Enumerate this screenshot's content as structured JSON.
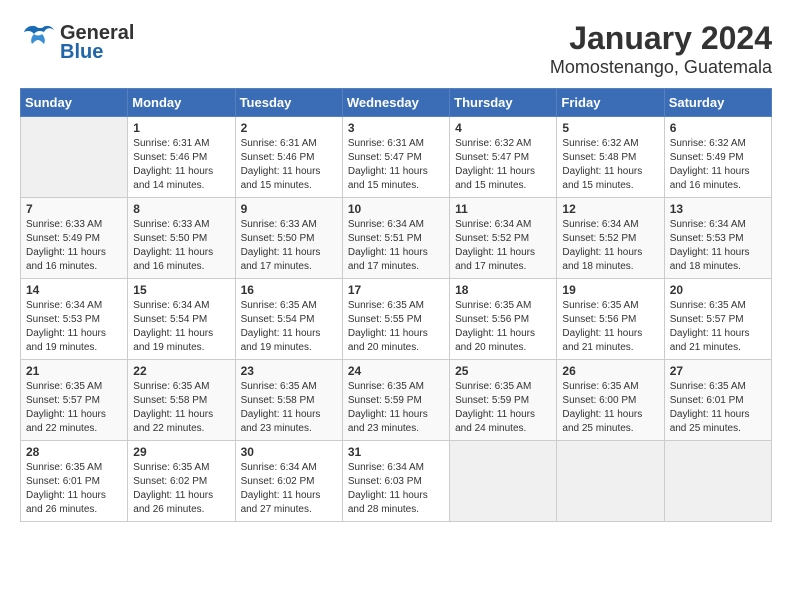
{
  "header": {
    "logo_general": "General",
    "logo_blue": "Blue",
    "title": "January 2024",
    "subtitle": "Momostenango, Guatemala"
  },
  "weekdays": [
    "Sunday",
    "Monday",
    "Tuesday",
    "Wednesday",
    "Thursday",
    "Friday",
    "Saturday"
  ],
  "weeks": [
    [
      {
        "day": "",
        "info": ""
      },
      {
        "day": "1",
        "info": "Sunrise: 6:31 AM\nSunset: 5:46 PM\nDaylight: 11 hours\nand 14 minutes."
      },
      {
        "day": "2",
        "info": "Sunrise: 6:31 AM\nSunset: 5:46 PM\nDaylight: 11 hours\nand 15 minutes."
      },
      {
        "day": "3",
        "info": "Sunrise: 6:31 AM\nSunset: 5:47 PM\nDaylight: 11 hours\nand 15 minutes."
      },
      {
        "day": "4",
        "info": "Sunrise: 6:32 AM\nSunset: 5:47 PM\nDaylight: 11 hours\nand 15 minutes."
      },
      {
        "day": "5",
        "info": "Sunrise: 6:32 AM\nSunset: 5:48 PM\nDaylight: 11 hours\nand 15 minutes."
      },
      {
        "day": "6",
        "info": "Sunrise: 6:32 AM\nSunset: 5:49 PM\nDaylight: 11 hours\nand 16 minutes."
      }
    ],
    [
      {
        "day": "7",
        "info": "Sunrise: 6:33 AM\nSunset: 5:49 PM\nDaylight: 11 hours\nand 16 minutes."
      },
      {
        "day": "8",
        "info": "Sunrise: 6:33 AM\nSunset: 5:50 PM\nDaylight: 11 hours\nand 16 minutes."
      },
      {
        "day": "9",
        "info": "Sunrise: 6:33 AM\nSunset: 5:50 PM\nDaylight: 11 hours\nand 17 minutes."
      },
      {
        "day": "10",
        "info": "Sunrise: 6:34 AM\nSunset: 5:51 PM\nDaylight: 11 hours\nand 17 minutes."
      },
      {
        "day": "11",
        "info": "Sunrise: 6:34 AM\nSunset: 5:52 PM\nDaylight: 11 hours\nand 17 minutes."
      },
      {
        "day": "12",
        "info": "Sunrise: 6:34 AM\nSunset: 5:52 PM\nDaylight: 11 hours\nand 18 minutes."
      },
      {
        "day": "13",
        "info": "Sunrise: 6:34 AM\nSunset: 5:53 PM\nDaylight: 11 hours\nand 18 minutes."
      }
    ],
    [
      {
        "day": "14",
        "info": "Sunrise: 6:34 AM\nSunset: 5:53 PM\nDaylight: 11 hours\nand 19 minutes."
      },
      {
        "day": "15",
        "info": "Sunrise: 6:34 AM\nSunset: 5:54 PM\nDaylight: 11 hours\nand 19 minutes."
      },
      {
        "day": "16",
        "info": "Sunrise: 6:35 AM\nSunset: 5:54 PM\nDaylight: 11 hours\nand 19 minutes."
      },
      {
        "day": "17",
        "info": "Sunrise: 6:35 AM\nSunset: 5:55 PM\nDaylight: 11 hours\nand 20 minutes."
      },
      {
        "day": "18",
        "info": "Sunrise: 6:35 AM\nSunset: 5:56 PM\nDaylight: 11 hours\nand 20 minutes."
      },
      {
        "day": "19",
        "info": "Sunrise: 6:35 AM\nSunset: 5:56 PM\nDaylight: 11 hours\nand 21 minutes."
      },
      {
        "day": "20",
        "info": "Sunrise: 6:35 AM\nSunset: 5:57 PM\nDaylight: 11 hours\nand 21 minutes."
      }
    ],
    [
      {
        "day": "21",
        "info": "Sunrise: 6:35 AM\nSunset: 5:57 PM\nDaylight: 11 hours\nand 22 minutes."
      },
      {
        "day": "22",
        "info": "Sunrise: 6:35 AM\nSunset: 5:58 PM\nDaylight: 11 hours\nand 22 minutes."
      },
      {
        "day": "23",
        "info": "Sunrise: 6:35 AM\nSunset: 5:58 PM\nDaylight: 11 hours\nand 23 minutes."
      },
      {
        "day": "24",
        "info": "Sunrise: 6:35 AM\nSunset: 5:59 PM\nDaylight: 11 hours\nand 23 minutes."
      },
      {
        "day": "25",
        "info": "Sunrise: 6:35 AM\nSunset: 5:59 PM\nDaylight: 11 hours\nand 24 minutes."
      },
      {
        "day": "26",
        "info": "Sunrise: 6:35 AM\nSunset: 6:00 PM\nDaylight: 11 hours\nand 25 minutes."
      },
      {
        "day": "27",
        "info": "Sunrise: 6:35 AM\nSunset: 6:01 PM\nDaylight: 11 hours\nand 25 minutes."
      }
    ],
    [
      {
        "day": "28",
        "info": "Sunrise: 6:35 AM\nSunset: 6:01 PM\nDaylight: 11 hours\nand 26 minutes."
      },
      {
        "day": "29",
        "info": "Sunrise: 6:35 AM\nSunset: 6:02 PM\nDaylight: 11 hours\nand 26 minutes."
      },
      {
        "day": "30",
        "info": "Sunrise: 6:34 AM\nSunset: 6:02 PM\nDaylight: 11 hours\nand 27 minutes."
      },
      {
        "day": "31",
        "info": "Sunrise: 6:34 AM\nSunset: 6:03 PM\nDaylight: 11 hours\nand 28 minutes."
      },
      {
        "day": "",
        "info": ""
      },
      {
        "day": "",
        "info": ""
      },
      {
        "day": "",
        "info": ""
      }
    ]
  ]
}
